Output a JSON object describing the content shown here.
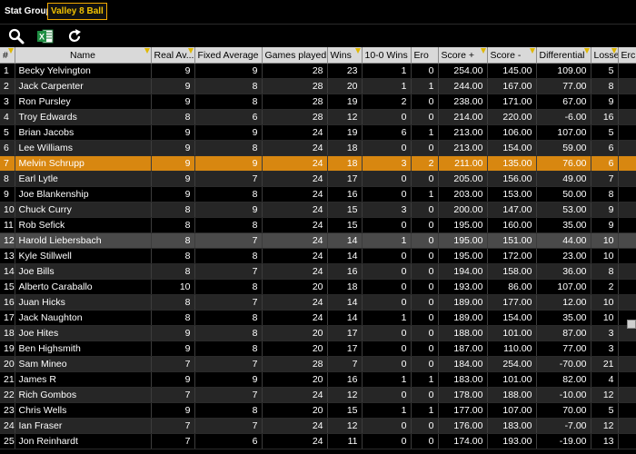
{
  "stat_group": {
    "label": "Stat Group",
    "value": "Valley 8 Ball"
  },
  "toolbar": {
    "search_icon": "search-icon",
    "excel_icon": "excel-icon",
    "refresh_icon": "refresh-icon"
  },
  "columns": [
    "#",
    "Name",
    "Real Av...",
    "Fixed Average",
    "Games played",
    "Wins",
    "10-0 Wins",
    "Ero",
    "Score +",
    "Score -",
    "Differential",
    "Losses",
    "Erc"
  ],
  "rows": [
    [
      "1",
      "Becky Yelvington",
      "9",
      "9",
      "28",
      "23",
      "1",
      "0",
      "254.00",
      "145.00",
      "109.00",
      "5",
      ""
    ],
    [
      "2",
      "Jack Carpenter",
      "9",
      "8",
      "28",
      "20",
      "1",
      "1",
      "244.00",
      "167.00",
      "77.00",
      "8",
      ""
    ],
    [
      "3",
      "Ron Pursley",
      "9",
      "8",
      "28",
      "19",
      "2",
      "0",
      "238.00",
      "171.00",
      "67.00",
      "9",
      ""
    ],
    [
      "4",
      "Troy Edwards",
      "8",
      "6",
      "28",
      "12",
      "0",
      "0",
      "214.00",
      "220.00",
      "-6.00",
      "16",
      ""
    ],
    [
      "5",
      "Brian Jacobs",
      "9",
      "9",
      "24",
      "19",
      "6",
      "1",
      "213.00",
      "106.00",
      "107.00",
      "5",
      ""
    ],
    [
      "6",
      "Lee Williams",
      "9",
      "8",
      "24",
      "18",
      "0",
      "0",
      "213.00",
      "154.00",
      "59.00",
      "6",
      ""
    ],
    [
      "7",
      "Melvin Schrupp",
      "9",
      "9",
      "24",
      "18",
      "3",
      "2",
      "211.00",
      "135.00",
      "76.00",
      "6",
      ""
    ],
    [
      "8",
      "Earl Lytle",
      "9",
      "7",
      "24",
      "17",
      "0",
      "0",
      "205.00",
      "156.00",
      "49.00",
      "7",
      ""
    ],
    [
      "9",
      "Joe Blankenship",
      "9",
      "8",
      "24",
      "16",
      "0",
      "1",
      "203.00",
      "153.00",
      "50.00",
      "8",
      ""
    ],
    [
      "10",
      "Chuck Curry",
      "8",
      "9",
      "24",
      "15",
      "3",
      "0",
      "200.00",
      "147.00",
      "53.00",
      "9",
      ""
    ],
    [
      "11",
      "Rob Sefick",
      "8",
      "8",
      "24",
      "15",
      "0",
      "0",
      "195.00",
      "160.00",
      "35.00",
      "9",
      ""
    ],
    [
      "12",
      "Harold Liebersbach",
      "8",
      "7",
      "24",
      "14",
      "1",
      "0",
      "195.00",
      "151.00",
      "44.00",
      "10",
      ""
    ],
    [
      "13",
      "Kyle Stillwell",
      "8",
      "8",
      "24",
      "14",
      "0",
      "0",
      "195.00",
      "172.00",
      "23.00",
      "10",
      ""
    ],
    [
      "14",
      "Joe Bills",
      "8",
      "7",
      "24",
      "16",
      "0",
      "0",
      "194.00",
      "158.00",
      "36.00",
      "8",
      ""
    ],
    [
      "15",
      "Alberto Caraballo",
      "10",
      "8",
      "20",
      "18",
      "0",
      "0",
      "193.00",
      "86.00",
      "107.00",
      "2",
      ""
    ],
    [
      "16",
      "Juan Hicks",
      "8",
      "7",
      "24",
      "14",
      "0",
      "0",
      "189.00",
      "177.00",
      "12.00",
      "10",
      ""
    ],
    [
      "17",
      "Jack Naughton",
      "8",
      "8",
      "24",
      "14",
      "1",
      "0",
      "189.00",
      "154.00",
      "35.00",
      "10",
      ""
    ],
    [
      "18",
      "Joe Hites",
      "9",
      "8",
      "20",
      "17",
      "0",
      "0",
      "188.00",
      "101.00",
      "87.00",
      "3",
      ""
    ],
    [
      "19",
      "Ben Highsmith",
      "9",
      "8",
      "20",
      "17",
      "0",
      "0",
      "187.00",
      "110.00",
      "77.00",
      "3",
      ""
    ],
    [
      "20",
      "Sam Mineo",
      "7",
      "7",
      "28",
      "7",
      "0",
      "0",
      "184.00",
      "254.00",
      "-70.00",
      "21",
      ""
    ],
    [
      "21",
      "James R",
      "9",
      "9",
      "20",
      "16",
      "1",
      "1",
      "183.00",
      "101.00",
      "82.00",
      "4",
      ""
    ],
    [
      "22",
      "Rich Gombos",
      "7",
      "7",
      "24",
      "12",
      "0",
      "0",
      "178.00",
      "188.00",
      "-10.00",
      "12",
      ""
    ],
    [
      "23",
      "Chris Wells",
      "9",
      "8",
      "20",
      "15",
      "1",
      "1",
      "177.00",
      "107.00",
      "70.00",
      "5",
      ""
    ],
    [
      "24",
      "Ian Fraser",
      "7",
      "7",
      "24",
      "12",
      "0",
      "0",
      "176.00",
      "183.00",
      "-7.00",
      "12",
      ""
    ],
    [
      "25",
      "Jon Reinhardt",
      "7",
      "6",
      "24",
      "11",
      "0",
      "0",
      "174.00",
      "193.00",
      "-19.00",
      "13",
      ""
    ]
  ],
  "selected_row": 7,
  "highlighted_row": 12
}
